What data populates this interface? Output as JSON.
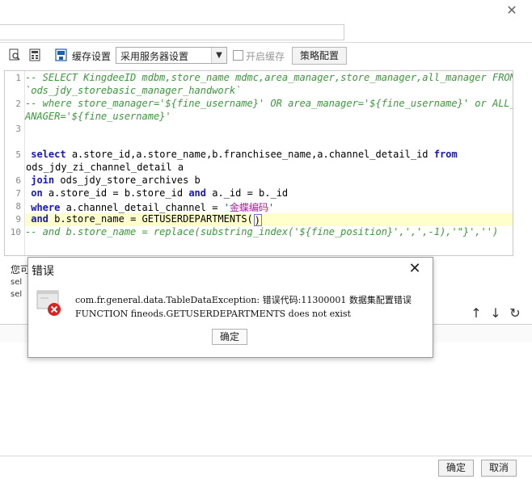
{
  "toolbar": {
    "cache_settings_label": "缓存设置",
    "cache_mode_value": "采用服务器设置",
    "enable_cache_label": "开启缓存",
    "strategy_button": "策略配置"
  },
  "editor": {
    "line_numbers": [
      "1",
      "2",
      "3",
      "5",
      "6",
      "7",
      "8",
      "9",
      "10"
    ],
    "lines": {
      "l1a": "-- SELECT KingdeeID mdbm,store_name mdmc,area_manager,store_manager,all_manager FROM",
      "l1b": "`ods_jdy_storebasic_manager_handwork`",
      "l2a": "-- where store_manager='${fine_username}' OR area_manager='${fine_username}' or ALL_M",
      "l2b": "ANAGER='${fine_username}'",
      "l5_kw1": "select",
      "l5_mid": " a.store_id,a.store_name,b.franchisee_name,a.channel_detail_id ",
      "l5_kw2": "from",
      "l5b": "ods_jdy_zi_channel_detail a",
      "l6_kw": "join",
      "l6_rest": " ods_jdy_store_archives b",
      "l7_kw1": "on",
      "l7_mid": " a.store_id = b.store_id ",
      "l7_kw2": "and",
      "l7_rest": " a._id = b._id",
      "l8_kw": "where",
      "l8_mid": " a.channel_detail_channel = ",
      "l8_str": "'金蝶编码'",
      "l9_kw": "and",
      "l9_rest": " b.store_name = GETUSERDEPARTMENTS(",
      "l9_close": ")",
      "l10": "-- and b.store_name = replace(substring_index('${fine_position}',',',-1),'\"}','')"
    }
  },
  "lower": {
    "label": "您可",
    "row1": "sel",
    "row2": "sel"
  },
  "dialog": {
    "title": "错误",
    "message_line1": "com.fr.general.data.TableDataException: 错误代码:11300001 数据集配置错误",
    "message_line2": "FUNCTION fineods.GETUSERDEPARTMENTS does not exist",
    "ok_button": "确定"
  },
  "footer": {
    "ok_button": "确定",
    "cancel_button": "取消"
  },
  "colors": {
    "comment": "#3a9a3a",
    "keyword": "#1515d4",
    "string": "#b5189f",
    "error_red": "#e02020",
    "highlight_line": "#ffffcc"
  }
}
